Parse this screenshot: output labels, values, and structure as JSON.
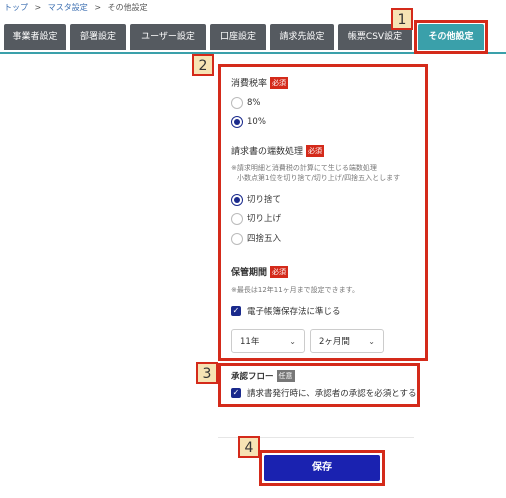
{
  "breadcrumb": {
    "home": "トップ",
    "sep": ">",
    "master": "マスタ設定",
    "current": "その他設定"
  },
  "tabs": [
    {
      "label": "事業者設定"
    },
    {
      "label": "部署設定"
    },
    {
      "label": "ユーザー設定"
    },
    {
      "label": "口座設定"
    },
    {
      "label": "請求先設定"
    },
    {
      "label": "帳票CSV設定"
    },
    {
      "label": "その他設定"
    }
  ],
  "callouts": {
    "n1": "1",
    "n2": "2",
    "n3": "3",
    "n4": "4"
  },
  "tax": {
    "title": "消費税率",
    "required": "必須",
    "options": [
      "8%",
      "10%"
    ],
    "selected": "10%"
  },
  "rounding": {
    "title": "請求書の端数処理",
    "required": "必須",
    "note1": "※請求明細と消費税の計算にて生じる端数処理",
    "note2": "小数点第1位を切り捨て/切り上げ/四捨五入とします",
    "options": [
      "切り捨て",
      "切り上げ",
      "四捨五入"
    ],
    "selected": "切り捨て"
  },
  "retention": {
    "title": "保管期間",
    "required": "必須",
    "note": "※最長は12年11ヶ月まで設定できます。",
    "checkbox_label": "電子帳簿保存法に準じる",
    "checked": true,
    "years": "11年",
    "months": "2ヶ月間"
  },
  "approval": {
    "title": "承認フロー",
    "optional": "任意",
    "checkbox_label": "請求書発行時に、承認者の承認を必須とする",
    "checked": true
  },
  "save_label": "保存",
  "colors": {
    "accent": "#3aa0aa",
    "primary": "#1a22b0",
    "callout": "#d42a1a",
    "tab": "#555a60"
  },
  "icons": {
    "check": "check-icon",
    "chevron": "chevron-down-icon"
  }
}
